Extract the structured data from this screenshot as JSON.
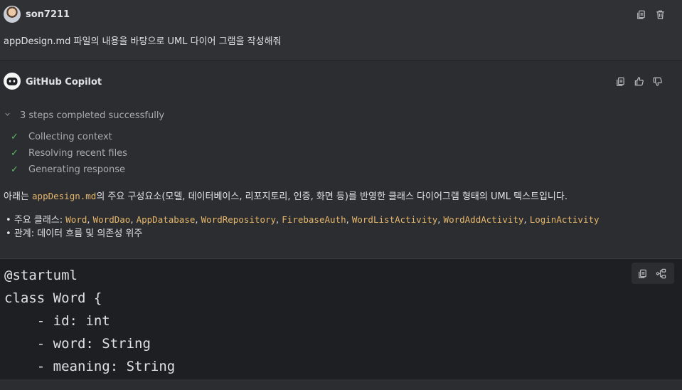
{
  "user": {
    "name": "son7211",
    "message": "appDesign.md 파일의 내용을 바탕으로 UML 다이어 그램을 작성해줘"
  },
  "assistant": {
    "name": "GitHub Copilot",
    "steps_summary": "3 steps completed successfully",
    "steps": [
      "Collecting context",
      "Resolving recent files",
      "Generating response"
    ],
    "intro": {
      "prefix": "아래는 ",
      "file": "appDesign.md",
      "suffix": "의 주요 구성요소(모델, 데이터베이스, 리포지토리, 인증, 화면 등)를 반영한 클래스 다이어그램 형태의 UML 텍스트입니다."
    },
    "classes_label": "주요 클래스: ",
    "classes": [
      "Word",
      "WordDao",
      "AppDatabase",
      "WordRepository",
      "FirebaseAuth",
      "WordListActivity",
      "WordAddActivity",
      "LoginActivity"
    ],
    "relations_label": "관계: 데이터 흐름 및 의존성 위주"
  },
  "code": {
    "lines": [
      "@startuml",
      "class Word {",
      "    - id: int",
      "    - word: String",
      "    - meaning: String"
    ]
  },
  "icons": {
    "copy": "copy-icon",
    "delete": "trash-icon",
    "thumbs_up": "thumbs-up-icon",
    "thumbs_down": "thumbs-down-icon",
    "diagram": "diagram-icon",
    "check": "check-icon",
    "chevron": "chevron-down-icon"
  },
  "colors": {
    "background": "#2b2d30",
    "code_background": "#1e1f22",
    "inline_code": "#e7b76c",
    "check": "#5fb865"
  }
}
